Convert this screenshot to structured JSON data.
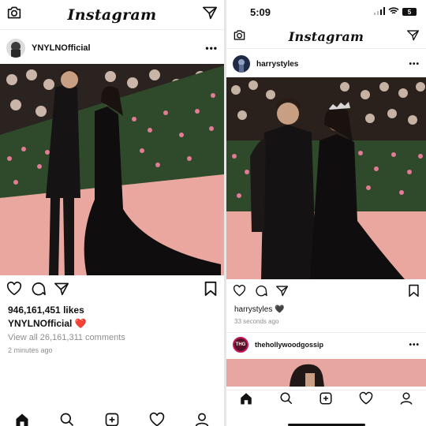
{
  "left": {
    "app_title": "Instagram",
    "post": {
      "username": "YNYLNOfficial",
      "likes": "946,161,451 likes",
      "caption_user": "YNYLNOfficial",
      "caption_emoji": "❤️",
      "comments_link": "View all 26,161,311 comments",
      "time_ago": "2 minutes ago"
    }
  },
  "right": {
    "status_time": "5:09",
    "battery_level": "5",
    "app_title": "Instagram",
    "post": {
      "username": "harrystyles",
      "caption_user": "harrystyles",
      "caption_emoji": "🖤",
      "time_ago": "33 seconds ago"
    },
    "next_post": {
      "username": "thehollywoodgossip",
      "avatar_text": "THG"
    }
  },
  "icons": {
    "header": [
      "camera-icon",
      "direct-message-icon"
    ],
    "post_actions": [
      "heart-icon",
      "comment-icon",
      "share-icon",
      "bookmark-icon"
    ],
    "tab_bar": [
      "home-icon",
      "search-icon",
      "add-post-icon",
      "activity-heart-icon",
      "profile-icon"
    ]
  },
  "colors": {
    "accent_red": "#ed4956",
    "muted_text": "#8e8e8e",
    "carpet_pink": "#e9a79f"
  }
}
